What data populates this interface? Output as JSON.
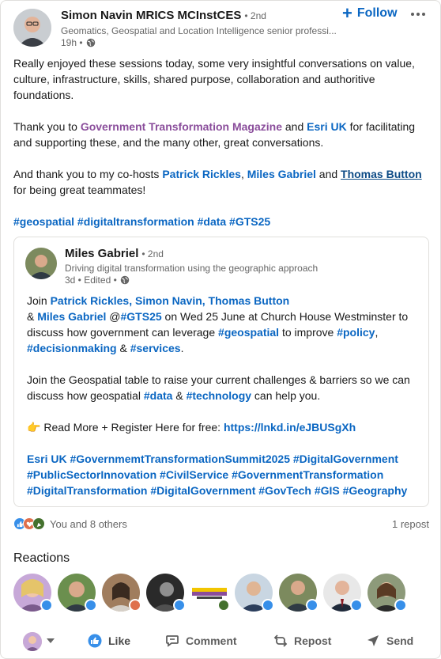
{
  "post": {
    "author_name": "Simon Navin MRICS MCInstCES",
    "degree": "• 2nd",
    "headline": "Geomatics, Geospatial and Location Intelligence senior professi...",
    "time": "19h •",
    "follow_label": "Follow",
    "paragraph1": "Really enjoyed these sessions today, some very insightful conversations on value, culture, infrastructure, skills, shared purpose, collaboration and authoritive foundations.",
    "p2_pre": "Thank you to ",
    "p2_mention1": "Government Transformation Magazine",
    "p2_mid": " and ",
    "p2_mention2": "Esri UK",
    "p2_post": " for facilitating and supporting these, and the many other, great conversations.",
    "p3_pre": "And thank you to my co-hosts ",
    "p3_mention1": "Patrick Rickles",
    "p3_comma": ", ",
    "p3_mention2": "Miles Gabriel",
    "p3_and": " and ",
    "p3_mention3": "Thomas Button",
    "p3_post": " for being great teammates!",
    "hashtags": "#geospatial #digitaltransformation #data #GTS25"
  },
  "reshare": {
    "author_name": "Miles Gabriel",
    "degree": "• 2nd",
    "headline": "Driving digital transformation using the geographic approach",
    "meta": "3d • Edited •",
    "l1_pre": "Join ",
    "l1_mentions": "Patrick Rickles, Simon Navin, Thomas Button",
    "l2_amp": "& ",
    "l2_mention": "Miles Gabriel",
    "l2_at": " @",
    "l2_tag": "#GTS25",
    "l2_post": " on Wed 25 June at Church House Westminster to discuss how government can leverage ",
    "l2_tag2": "#geospatial",
    "l2_to": " to improve ",
    "l2_tag3": "#policy",
    "l2_comma": ", ",
    "l2_tag4": "#decisionmaking",
    "l2_amp2": " & ",
    "l2_tag5": "#services",
    "l2_end": ".",
    "p2_pre": "Join the Geospatial table to raise your current challenges & barriers so we can discuss how geospatial ",
    "p2_tag1": "#data",
    "p2_amp": " & ",
    "p2_tag2": "#technology",
    "p2_post": " can help you.",
    "p3_emoji": "👉",
    "p3_text": " Read More + Register Here for free: ",
    "p3_link": "https://lnkd.in/eJBUSgXh",
    "p4_mention": "Esri UK",
    "p4_tags": " #GovernmemtTransformationSummit2025 #DigitalGovernment #PublicSectorInnovation #CivilService #GovernmentTransformation #DigitalTransformation #DigitalGovernment #GovTech #GIS #Geography"
  },
  "social": {
    "reactors": "You and 8 others",
    "reposts": "1 repost"
  },
  "reactions_title": "Reactions",
  "actions": {
    "like": "Like",
    "comment": "Comment",
    "repost": "Repost",
    "send": "Send"
  },
  "colors": {
    "link_blue": "#0a66c2",
    "purple_mention": "#8a4d9b",
    "muted": "#666666"
  }
}
